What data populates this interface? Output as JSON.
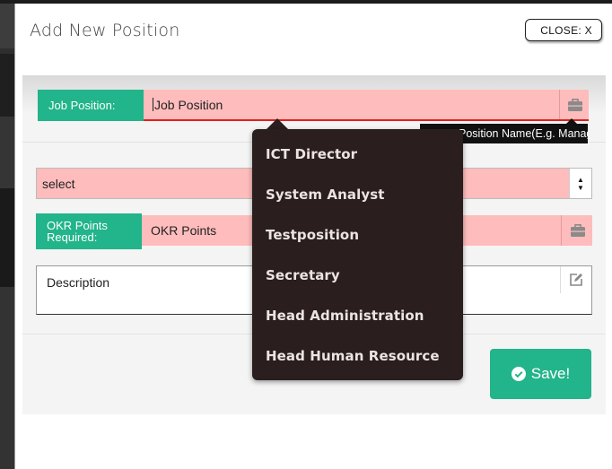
{
  "modal": {
    "title": "Add New Position",
    "close_label": "CLOSE: X"
  },
  "job_position": {
    "label": "Job Position:",
    "value": "Job Position",
    "icon": "briefcase-icon",
    "tooltip": "Position Name(E.g. Managers)"
  },
  "select_field": {
    "value": "select"
  },
  "okr": {
    "label_line1": "OKR Points",
    "label_line2": "Required:",
    "value": "OKR Points",
    "icon": "briefcase-icon"
  },
  "description": {
    "value": "Description",
    "icon": "edit-icon"
  },
  "save_button": {
    "label": "Save!",
    "icon": "check-circle-icon"
  },
  "dropdown": {
    "items": [
      "ICT Director",
      "System Analyst",
      "Testposition",
      "Secretary",
      "Head Administration",
      "Head Human Resource"
    ]
  },
  "colors": {
    "accent_green": "#22b48a",
    "field_pink": "#ffbcbc",
    "underline_red": "#e0201c",
    "dropdown_bg": "#2a1e1e"
  }
}
